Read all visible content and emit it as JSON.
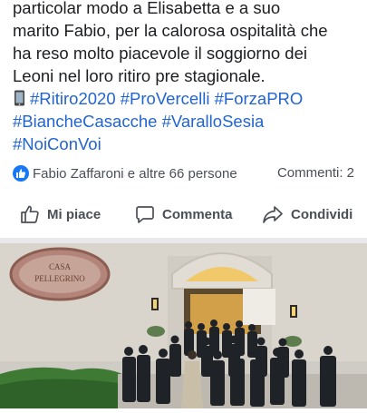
{
  "post": {
    "lines": [
      "particolar modo a Elisabetta e a suo",
      "marito Fabio, per la calorosa ospitalità che",
      "ha reso molto piacevole il soggiorno dei",
      "Leoni nel loro ritiro pre stagionale."
    ],
    "hashtags": [
      "#Ritiro2020",
      "#ProVercelli",
      "#ForzaPRO",
      "#BiancheCasacche",
      "#VaralloSesia",
      "#NoiConVoi"
    ]
  },
  "reactions": {
    "names": "Fabio Zaffaroni e altre 66 persone",
    "comments": "Commenti: 2"
  },
  "actions": {
    "like": "Mi piace",
    "comment": "Commenta",
    "share": "Condividi"
  },
  "photo": {
    "sign_line1": "CASA",
    "sign_line2": "PELLEGRINO"
  },
  "colors": {
    "hashtag": "#2265cf",
    "like_badge": "#1877f2",
    "action_text": "#4b4f56"
  }
}
